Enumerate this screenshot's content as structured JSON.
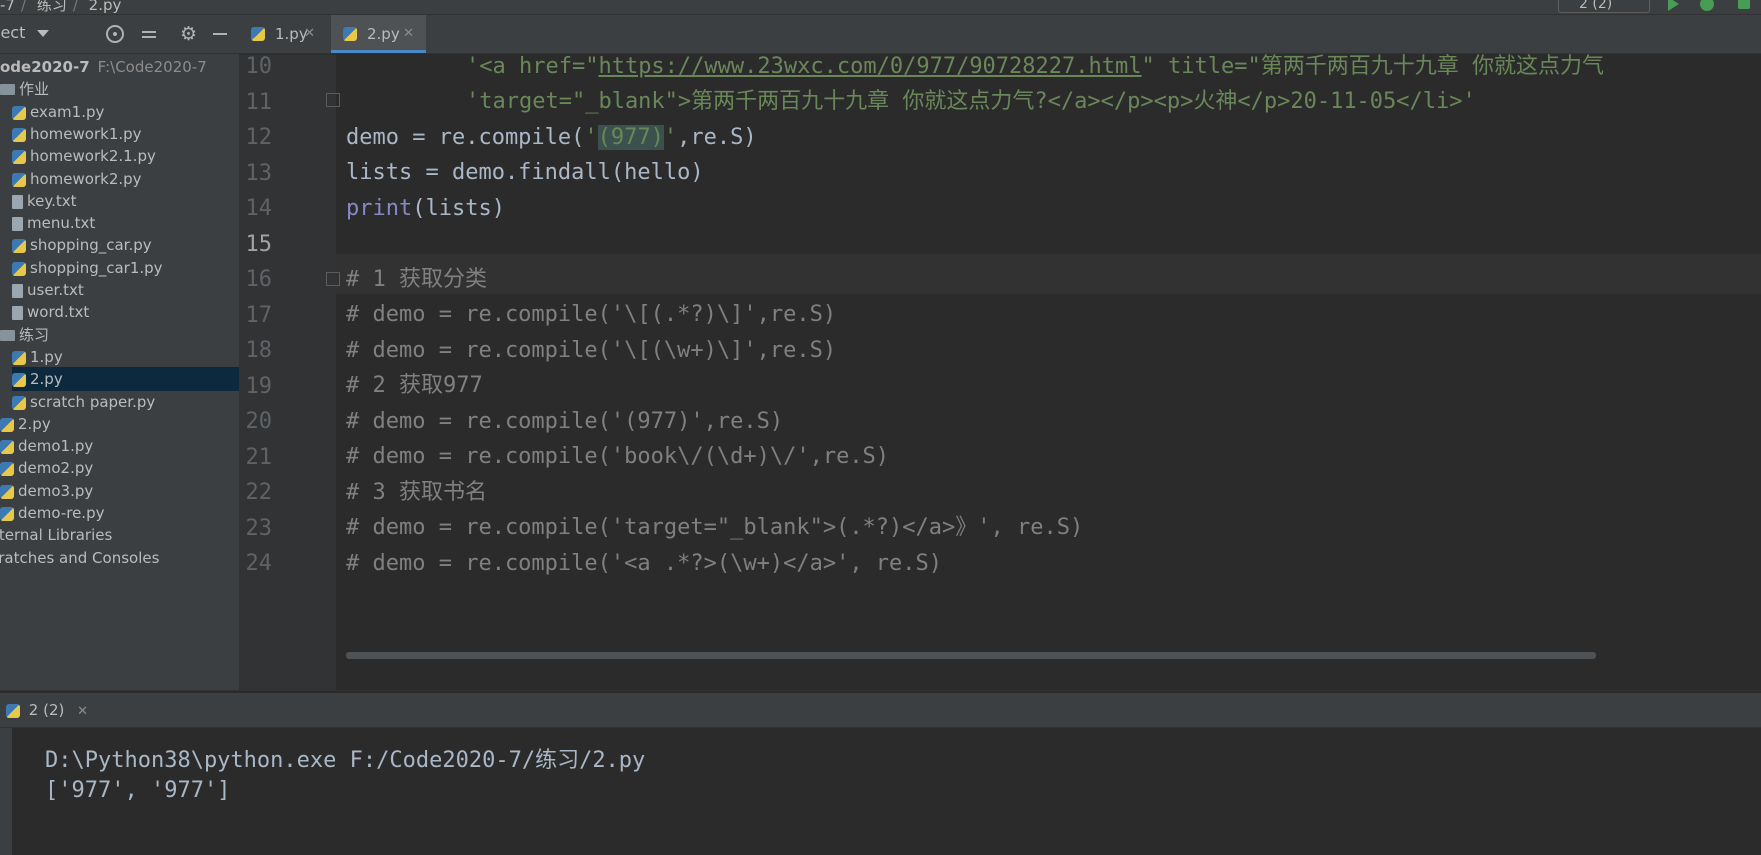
{
  "breadcrumb": [
    "-7",
    "练习",
    "2.py"
  ],
  "run_config": "2 (2)",
  "project_panel": {
    "title": "ject",
    "items": [
      {
        "label": "ode2020-7",
        "path": "F:\\Code2020-7",
        "type": "folder"
      },
      {
        "label": "作业",
        "type": "folder"
      },
      {
        "label": "exam1.py",
        "type": "py"
      },
      {
        "label": "homework1.py",
        "type": "py"
      },
      {
        "label": "homework2.1.py",
        "type": "py"
      },
      {
        "label": "homework2.py",
        "type": "py"
      },
      {
        "label": "key.txt",
        "type": "txt"
      },
      {
        "label": "menu.txt",
        "type": "txt"
      },
      {
        "label": "shopping_car.py",
        "type": "py"
      },
      {
        "label": "shopping_car1.py",
        "type": "py"
      },
      {
        "label": "user.txt",
        "type": "txt"
      },
      {
        "label": "word.txt",
        "type": "txt"
      },
      {
        "label": "练习",
        "type": "folder"
      },
      {
        "label": "1.py",
        "type": "py"
      },
      {
        "label": "2.py",
        "type": "py"
      },
      {
        "label": "scratch paper.py",
        "type": "py"
      },
      {
        "label": "2.py",
        "type": "py"
      },
      {
        "label": "demo1.py",
        "type": "py"
      },
      {
        "label": "demo2.py",
        "type": "py"
      },
      {
        "label": "demo3.py",
        "type": "py"
      },
      {
        "label": "demo-re.py",
        "type": "py"
      },
      {
        "label": "xternal Libraries",
        "type": "lib"
      },
      {
        "label": "cratches and Consoles",
        "type": "lib"
      }
    ]
  },
  "tabs": [
    {
      "label": "1.py",
      "active": false
    },
    {
      "label": "2.py",
      "active": true
    }
  ],
  "editor": {
    "line_numbers": [
      "10",
      "11",
      "12",
      "13",
      "14",
      "15",
      "16",
      "17",
      "18",
      "19",
      "20",
      "21",
      "22",
      "23",
      "24"
    ],
    "current_line": "15",
    "lines": {
      "l10": {
        "q1": "'<a href=\"",
        "url": "https://www.23wxc.com/0/977/90728227.html",
        "q2": "\" title=\"第两千两百九十九章 你就这点力气"
      },
      "l11": "'target=\"_blank\">第两千两百九十九章 你就这点力气?</a></p><p>火神</p>20-11-05</li>'",
      "l12": {
        "pre": "demo = re.compile(",
        "q1": "'",
        "hl": "(977)",
        "q2": "'",
        "post": ",re.S)"
      },
      "l13": "lists = demo.findall(hello)",
      "l14": {
        "kw": "print",
        "rest": "(lists)"
      },
      "l15": "",
      "l16": "# 1 获取分类",
      "l17": "# demo = re.compile('\\[(.*?)\\]',re.S)",
      "l18": "# demo = re.compile('\\[(\\w+)\\]',re.S)",
      "l19": "# 2 获取977",
      "l20": "# demo = re.compile('(977)',re.S)",
      "l21": "# demo = re.compile('book\\/(\\d+)\\/',re.S)",
      "l22": "# 3 获取书名",
      "l23": "# demo = re.compile('target=\"_blank\">(.*?)</a>》', re.S)",
      "l24": "# demo = re.compile('<a .*?>(\\w+)</a>', re.S)"
    }
  },
  "run_panel": {
    "tab_label": "2 (2)",
    "output": [
      "D:\\Python38\\python.exe F:/Code2020-7/练习/2.py",
      "['977', '977']"
    ]
  }
}
